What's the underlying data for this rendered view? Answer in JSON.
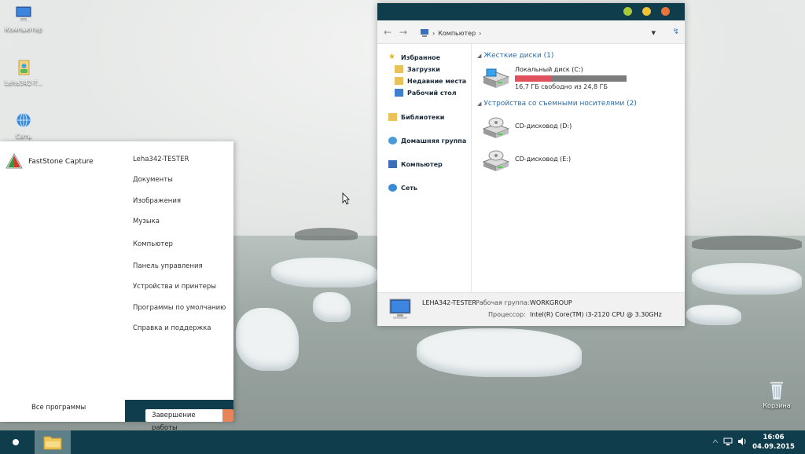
{
  "desktop": {
    "icons": [
      {
        "label": "Компьютер"
      },
      {
        "label": "Leha342-T..."
      },
      {
        "label": "Сеть"
      }
    ],
    "recycle_bin": {
      "label": "Корзина"
    }
  },
  "start_menu": {
    "pinned_app": "FastStone Capture",
    "all_programs": "Все программы",
    "right_links": [
      "Leha342-TESTER",
      "Документы",
      "Изображения",
      "Музыка",
      "Компьютер",
      "Панель управления",
      "Устройства и принтеры",
      "Программы по умолчанию",
      "Справка и поддержка"
    ],
    "shutdown_label": "Завершение работы"
  },
  "explorer": {
    "traffic_lights": [
      "#a9c93a",
      "#f1c232",
      "#e8743b"
    ],
    "address": {
      "segment": "Компьютер",
      "separator": "›"
    },
    "nav": {
      "favorites": "Избранное",
      "downloads": "Загрузки",
      "recent": "Недавние места",
      "desktop": "Рабочий стол",
      "libraries": "Библиотеки",
      "homegroup": "Домашняя группа",
      "computer": "Компьютер",
      "network": "Сеть"
    },
    "groups": {
      "hard_disks": "Жесткие диски (1)",
      "removable": "Устройства со съемными носителями (2)"
    },
    "drives": {
      "c": {
        "name": "Локальный диск (C:)",
        "free_text": "16,7 ГБ свободно из 24,8 ГБ",
        "used_fraction": 0.33
      },
      "d": {
        "name": "CD-дисковод (D:)"
      },
      "e": {
        "name": "CD-дисковод (E:)"
      }
    },
    "details": {
      "computer_name": "LEHA342-TESTER",
      "workgroup_label": "Рабочая группа:",
      "workgroup_value": "WORKGROUP",
      "cpu_label": "Процессор:",
      "cpu_value": "Intel(R) Core(TM) i3-2120 CPU @ 3.30GHz"
    }
  },
  "taskbar": {
    "time": "16:06",
    "date": "04.09.2015"
  }
}
